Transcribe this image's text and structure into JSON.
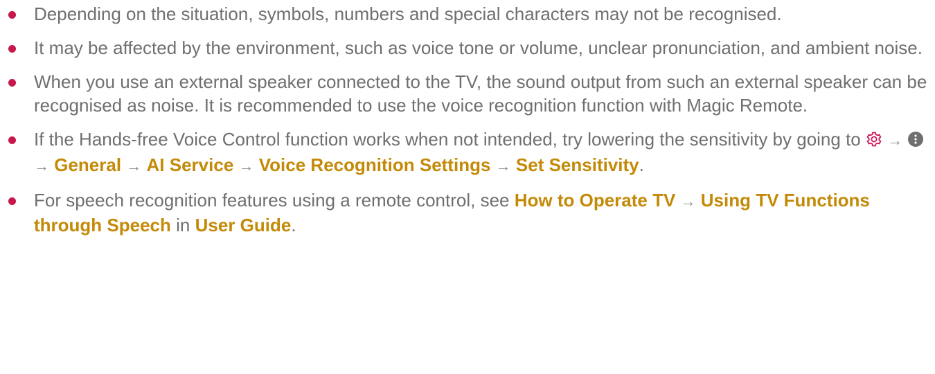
{
  "colors": {
    "bullet": "#c8174c",
    "text": "#6f6f6f",
    "highlight": "#c48a07",
    "icon": "#d0145a"
  },
  "notes": [
    {
      "text": "Depending on the situation, symbols, numbers and special characters may not be recognised."
    },
    {
      "text": "It may be affected by the environment, such as voice tone or volume, unclear pronunciation, and ambient noise."
    },
    {
      "text": "When you use an external speaker connected to the TV, the sound output from such an external speaker can be recognised as noise. It is recommended to use the voice recognition function with Magic Remote."
    },
    {
      "prefix": "If the Hands-free Voice Control function works when not intended, try lowering the sensitivity by going to",
      "icons": [
        "settings-gear-icon",
        "more-options-icon"
      ],
      "path": [
        "General",
        "AI Service",
        "Voice Recognition Settings",
        "Set Sensitivity"
      ],
      "arrow": "→",
      "suffix": "."
    },
    {
      "prefix": "For speech recognition features using a remote control, see",
      "path": [
        "How to Operate TV",
        "Using TV Functions through Speech"
      ],
      "arrow": "→",
      "connector": "in",
      "guide": "User Guide",
      "suffix": "."
    }
  ]
}
